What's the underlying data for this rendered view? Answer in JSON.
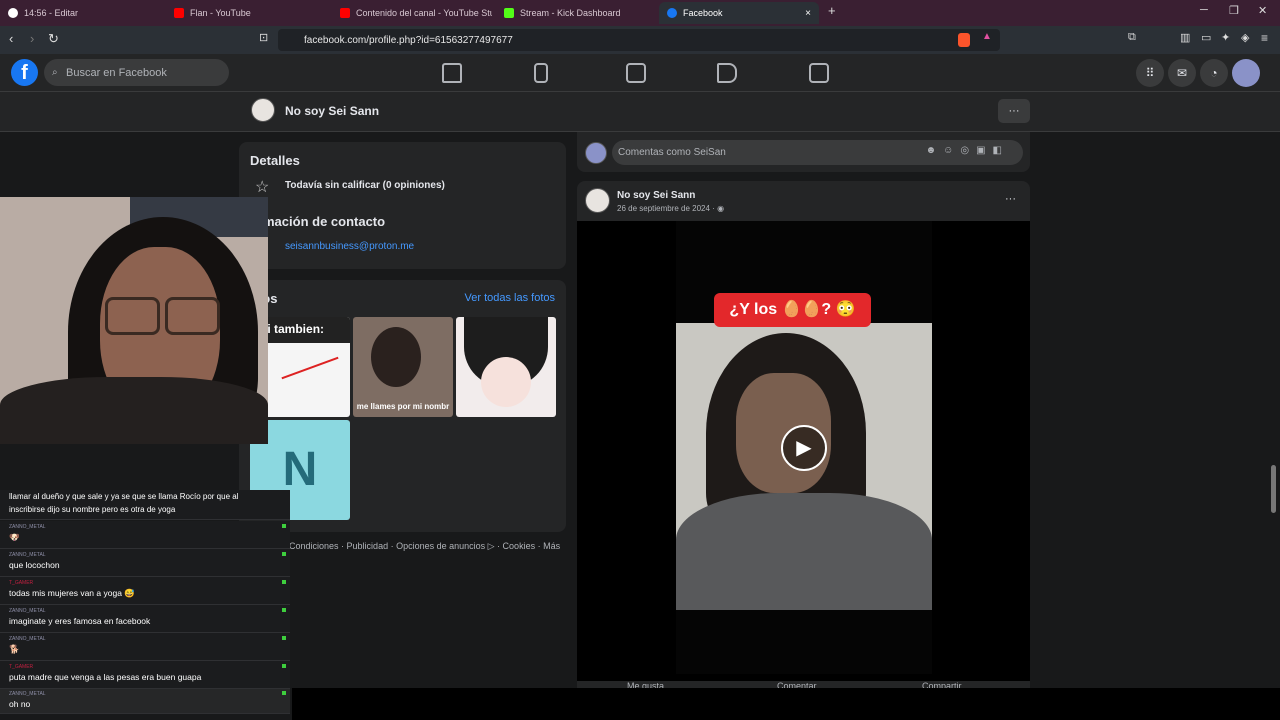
{
  "browser": {
    "tabs": [
      {
        "label": "14:56 - Editar",
        "icon": "check-circle-icon",
        "color": "#ffffff"
      },
      {
        "label": "Flan - YouTube",
        "icon": "youtube-icon",
        "color": "#ff0000"
      },
      {
        "label": "Contenido del canal - YouTube Studio",
        "icon": "youtube-icon",
        "color": "#ff0000"
      },
      {
        "label": "Stream - Kick Dashboard",
        "icon": "kick-icon",
        "color": "#53fc18"
      },
      {
        "label": "Facebook",
        "icon": "facebook-icon",
        "color": "#1877f2"
      }
    ],
    "new_tab": "+",
    "close_tab": "×",
    "url": "facebook.com/profile.php?id=61563277497677"
  },
  "facebook": {
    "logo": "f",
    "search_placeholder": "Buscar en Facebook",
    "profile_name": "No soy Sei Sann",
    "more": "···"
  },
  "details": {
    "title": "Detalles",
    "rating": "Todavía sin calificar (0 opiniones)",
    "contact_title": "Información de contacto",
    "contact_title_visible": "ormación de contacto",
    "email": "seisannbusiness@proton.me"
  },
  "photos": {
    "title_visible": "otos",
    "see_all": "Ver todas las fotos",
    "thumb1_text": "sei tambien:",
    "thumb2_text": "me llames por mi nombr",
    "thumb4_text": "N"
  },
  "footer": {
    "links": "Privacidad · Condiciones · Publicidad · Opciones de anuncios ▷ · Cookies · Más"
  },
  "comment_box": {
    "placeholder": "Comentas como SeiSan"
  },
  "post": {
    "author": "No soy Sei Sann",
    "date": "26 de septiembre de 2024 ·",
    "caption": "¿Y los 🥚🥚? 😳",
    "actions": [
      "Me gusta",
      "Comentar",
      "Compartir"
    ]
  },
  "chat": {
    "partial_top": "llamar al dueño y que sale y ya se que se llama Rocío por que al",
    "partial_top2": "inscribirse dijo su nombre pero es otra de yoga",
    "messages": [
      {
        "user": "ZANNO_METAL",
        "text": "🐶"
      },
      {
        "user": "ZANNO_METAL",
        "text": "que locochon"
      },
      {
        "user": "T_GAMER",
        "text": "todas mis mujeres van a yoga 😅"
      },
      {
        "user": "ZANNO_METAL",
        "text": "imaginate y eres famosa en facebook"
      },
      {
        "user": "ZANNO_METAL",
        "text": "🐕"
      },
      {
        "user": "T_GAMER",
        "text": "puta madre que venga a las pesas era buen guapa"
      },
      {
        "user": "ZANNO_METAL",
        "text": "oh no"
      }
    ]
  },
  "colors": {
    "accent": "#1877f2",
    "link": "#4599ff",
    "tabbar": "#3a1f32"
  }
}
